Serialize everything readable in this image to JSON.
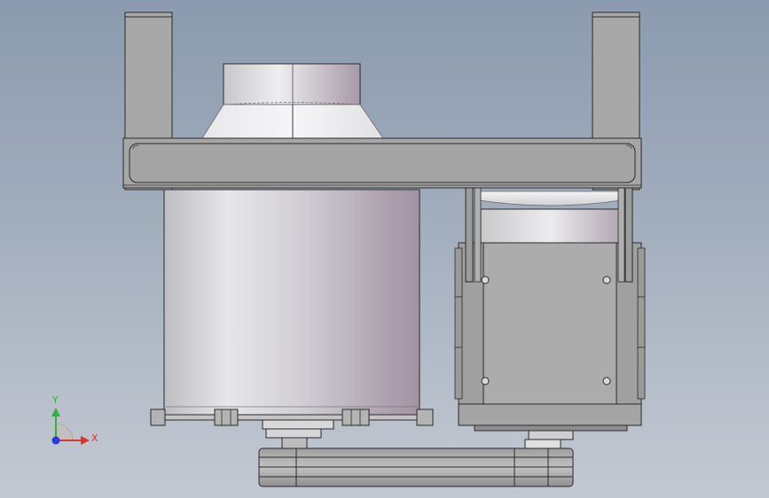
{
  "triad": {
    "x_label": "X",
    "y_label": "Y",
    "x_color": "#e0322a",
    "y_color": "#2fb13a",
    "z_color": "#2a3ad8"
  },
  "palette": {
    "frame_gray": "#a8a8a8",
    "frame_dark": "#8e8e8e",
    "metal_light": "#e4e4e8",
    "metal_dark": "#a99aa8",
    "outline": "#2a2a2a"
  }
}
